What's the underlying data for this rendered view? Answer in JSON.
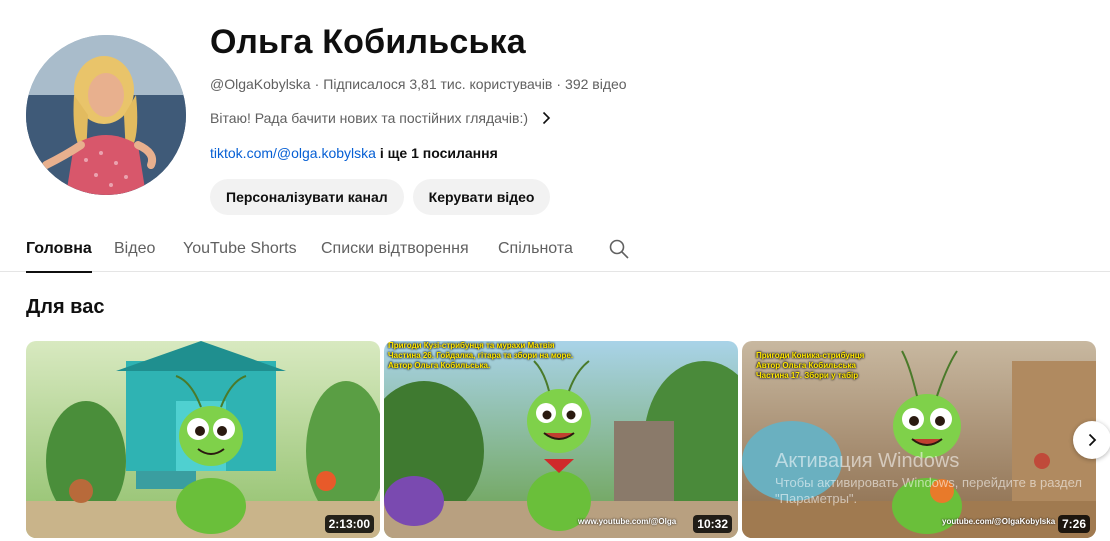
{
  "channel": {
    "name": "Ольга Кобильська",
    "handle": "@OlgaKobylska",
    "subscribers": "Підписалося 3,81 тис. користувачів",
    "videos": "392 відео",
    "separator": "·",
    "description": "Вітаю! Рада бачити нових та постійних глядачів:)",
    "link": "tiktok.com/@olga.kobylska",
    "more_links": "і ще 1 посилання",
    "buttons": {
      "customize": "Персоналізувати канал",
      "manage": "Керувати відео"
    }
  },
  "tabs": [
    {
      "label": "Головна",
      "active": true
    },
    {
      "label": "Відео",
      "active": false
    },
    {
      "label": "YouTube Shorts",
      "active": false
    },
    {
      "label": "Списки відтворення",
      "active": false
    },
    {
      "label": "Спільнота",
      "active": false
    }
  ],
  "section": {
    "title": "Для вас"
  },
  "videos": [
    {
      "duration": "2:13:00",
      "caption": "",
      "url_overlay": ""
    },
    {
      "duration": "10:32",
      "caption": "Пригоди Кузі-стрибунця та мурахи Матвія\nЧастина 26. Гойдалка, гітара та збори на море.\nАвтор Ольга Кобильська.",
      "url_overlay": "www.youtube.com/@Olga"
    },
    {
      "duration": "7:26",
      "caption": "Пригоди Коника-стрибунця\nАвтор Ольга Кобильська\nЧастина 17. Збори у табір",
      "url_overlay": "youtube.com/@OlgaKobylska"
    }
  ],
  "watermark": {
    "title": "Активация Windows",
    "subtitle": "Чтобы активировать Windows, перейдите в раздел \"Параметры\"."
  },
  "icons": {
    "search": "search-icon",
    "chevron": "chevron-right-icon",
    "next": "next-arrow-icon"
  },
  "colors": {
    "link": "#065fd4",
    "button_bg": "#f2f2f2",
    "text_secondary": "#606060"
  }
}
